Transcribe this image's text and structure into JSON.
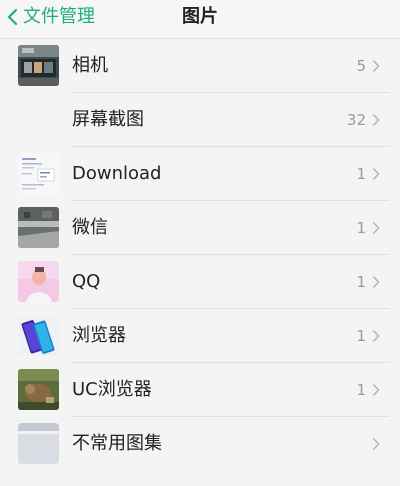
{
  "header": {
    "back_label": "文件管理",
    "title": "图片"
  },
  "albums": [
    {
      "name": "相机",
      "count": "5",
      "thumb": "camera-photo-thumbnail"
    },
    {
      "name": "屏幕截图",
      "count": "32",
      "thumb": ""
    },
    {
      "name": "Download",
      "count": "1",
      "thumb": "download-document-thumbnail"
    },
    {
      "name": "微信",
      "count": "1",
      "thumb": "wechat-photo-thumbnail"
    },
    {
      "name": "QQ",
      "count": "1",
      "thumb": "qq-photo-thumbnail"
    },
    {
      "name": "浏览器",
      "count": "1",
      "thumb": "browser-phone-thumbnail"
    },
    {
      "name": "UC浏览器",
      "count": "1",
      "thumb": "uc-browser-photo-thumbnail"
    },
    {
      "name": "不常用图集",
      "count": "",
      "thumb": "folder-icon"
    }
  ],
  "colors": {
    "accent": "#1fae7a",
    "text": "#222222",
    "secondary_text": "#9a9a9a",
    "background": "#f4f4f4"
  }
}
